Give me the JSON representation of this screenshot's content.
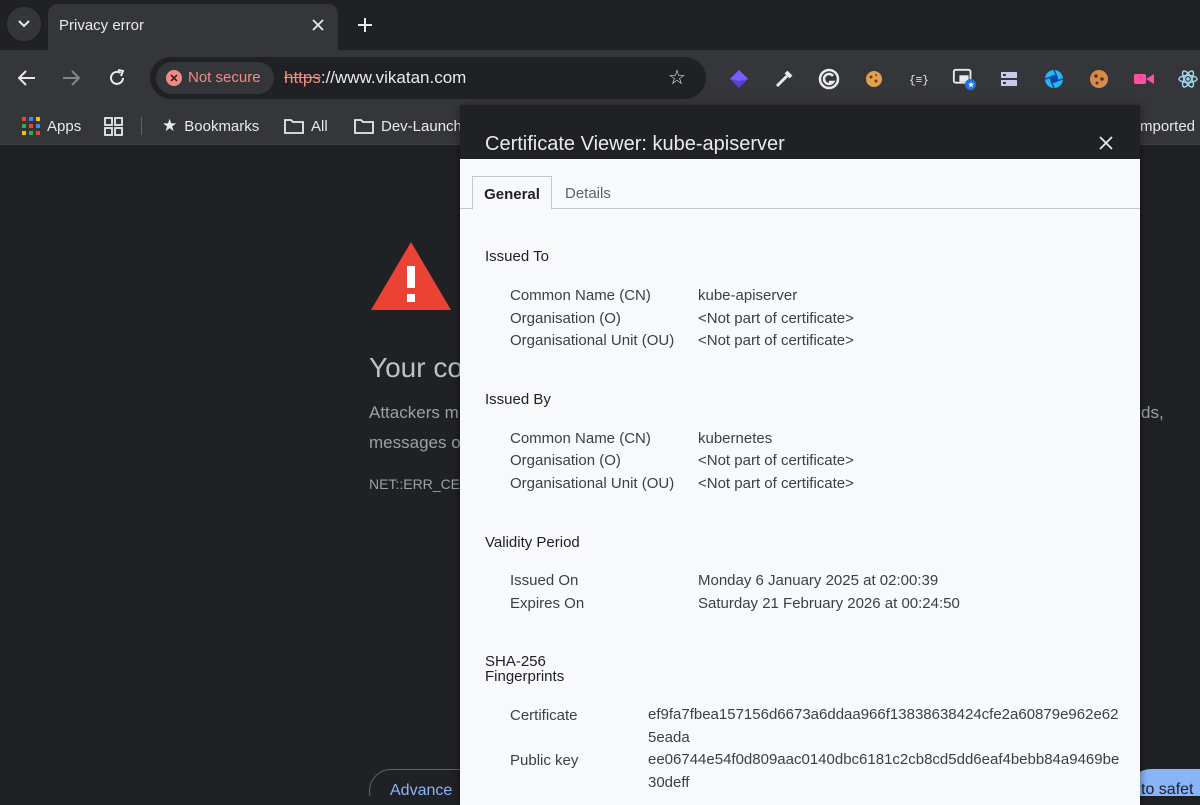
{
  "browser": {
    "tab": {
      "title": "Privacy error"
    },
    "omnibox": {
      "security_label": "Not secure",
      "url_scheme": "https",
      "url_rest": "://www.vikatan.com"
    },
    "bookmarks": {
      "apps": "Apps",
      "bookmarks": "Bookmarks",
      "all": "All",
      "dev_launch": "Dev-Launch",
      "imported": "mported"
    }
  },
  "page": {
    "heading": "Your co",
    "body_line1": "Attackers m",
    "body_line2": "messages o",
    "body_right": "ds,",
    "error_code": "NET::ERR_CER",
    "advanced_button": "Advance",
    "safety_button": "to safet"
  },
  "dialog": {
    "title": "Certificate Viewer: kube-apiserver",
    "tabs": {
      "general": "General",
      "details": "Details"
    },
    "issued_to": {
      "title": "Issued To",
      "rows": [
        {
          "label": "Common Name (CN)",
          "value": "kube-apiserver"
        },
        {
          "label": "Organisation (O)",
          "value": "<Not part of certificate>"
        },
        {
          "label": "Organisational Unit (OU)",
          "value": "<Not part of certificate>"
        }
      ]
    },
    "issued_by": {
      "title": "Issued By",
      "rows": [
        {
          "label": "Common Name (CN)",
          "value": "kubernetes"
        },
        {
          "label": "Organisation (O)",
          "value": "<Not part of certificate>"
        },
        {
          "label": "Organisational Unit (OU)",
          "value": "<Not part of certificate>"
        }
      ]
    },
    "validity": {
      "title": "Validity Period",
      "rows": [
        {
          "label": "Issued On",
          "value": "Monday 6 January 2025 at 02:00:39"
        },
        {
          "label": "Expires On",
          "value": "Saturday 21 February 2026 at 00:24:50"
        }
      ]
    },
    "fingerprints": {
      "title_line1": "SHA-256",
      "title_line2": "Fingerprints",
      "rows": [
        {
          "label": "Certificate",
          "value": "ef9fa7fbea157156d6673a6ddaa966f13838638424cfe2a60879e962e625eada"
        },
        {
          "label": "Public key",
          "value": "ee06744e54f0d809aac0140dbc6181c2cb8cd5dd6eaf4bebb84a9469be30deff"
        }
      ]
    }
  },
  "colors": {
    "accent_blue": "#8ab4f8",
    "warning_red": "#ea4335",
    "not_secure": "#f28b82"
  }
}
